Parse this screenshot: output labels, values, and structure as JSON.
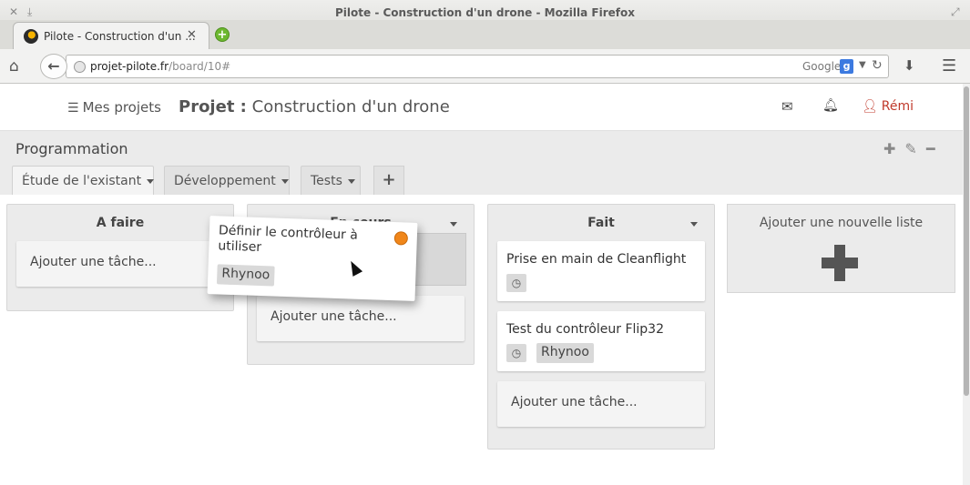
{
  "window": {
    "title": "Pilote - Construction d'un drone - Mozilla Firefox",
    "tab_title": "Pilote - Construction d'un ...",
    "url_host": "projet-pilote.fr",
    "url_path": "/board/10#",
    "search_engine": "Google"
  },
  "header": {
    "my_projects": "Mes projets",
    "project_prefix": "Projet :",
    "project_name": "Construction d'un drone",
    "user_name": "Rémi"
  },
  "board": {
    "title": "Programmation",
    "tabs": [
      {
        "label": "Étude de l'existant"
      },
      {
        "label": "Développement"
      },
      {
        "label": "Tests"
      }
    ]
  },
  "lists": [
    {
      "title": "A faire",
      "add_task": "Ajouter une tâche..."
    },
    {
      "title": "En cours",
      "add_task": "Ajouter une tâche..."
    },
    {
      "title": "Fait",
      "cards": [
        {
          "text": "Prise en main de Cleanflight"
        },
        {
          "text": "Test du contrôleur Flip32",
          "tag": "Rhynoo"
        }
      ],
      "add_task": "Ajouter une tâche..."
    }
  ],
  "add_list": {
    "label": "Ajouter une nouvelle liste"
  },
  "dragged_card": {
    "text": "Définir le contrôleur à utiliser",
    "tag": "Rhynoo",
    "status_color": "#f0861a"
  },
  "colors": {
    "user_accent": "#c0392b",
    "board_bg": "#ebebeb"
  }
}
